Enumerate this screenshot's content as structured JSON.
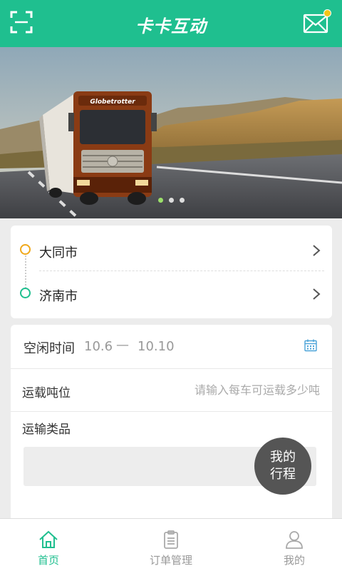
{
  "header": {
    "title": "卡卡互动",
    "left_icon": "scan-icon",
    "right_icon": "mail-icon",
    "has_notification": true
  },
  "banner": {
    "truck_brand": "Globetrotter",
    "slides_count": 3,
    "active_slide": 1
  },
  "route": {
    "from": "大同市",
    "to": "济南市"
  },
  "form": {
    "free_time_label": "空闲时间",
    "time_start": "10.6",
    "time_sep": "—",
    "time_end": "10.10",
    "tonnage_label": "运载吨位",
    "tonnage_placeholder": "请输入每车可运载多少吨",
    "goods_label": "运输类品"
  },
  "float_button": {
    "line1": "我的",
    "line2": "行程"
  },
  "nav": {
    "home": "首页",
    "orders": "订单管理",
    "mine": "我的"
  },
  "colors": {
    "primary": "#1fbf8f",
    "orange": "#f0a81a",
    "badge": "#f5c518"
  }
}
